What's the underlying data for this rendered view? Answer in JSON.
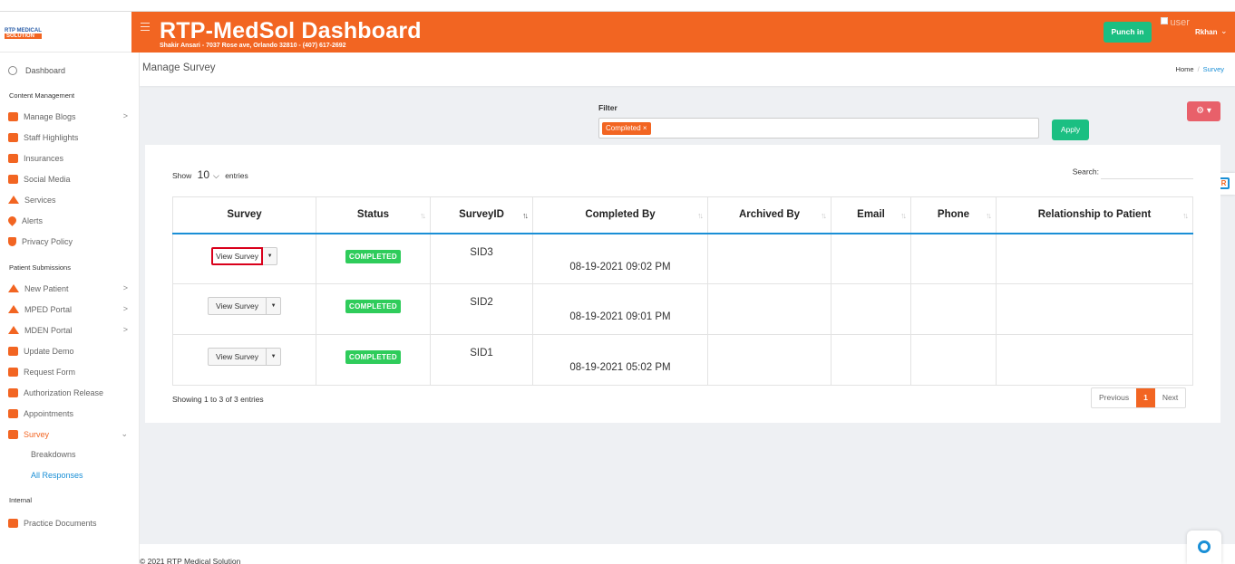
{
  "header": {
    "title": "RTP-MedSol Dashboard",
    "subtitle": "Shakir Ansari - 7037 Rose ave, Orlando 32810 - (407) 617-2692",
    "punch_label": "Punch in",
    "user_alt": "user",
    "user_name": "Rkhan"
  },
  "logo": {
    "line1": "RTP MEDICAL",
    "line2": "SOLUTION"
  },
  "sidebar": {
    "dashboard": "Dashboard",
    "sections": [
      {
        "title": "Content Management",
        "items": [
          "Manage Blogs",
          "Staff Highlights",
          "Insurances",
          "Social Media",
          "Services",
          "Alerts",
          "Privacy Policy"
        ]
      },
      {
        "title": "Patient Submissions",
        "items": [
          "New Patient",
          "MPED Portal",
          "MDEN Portal",
          "Update Demo",
          "Request Form",
          "Authorization Release",
          "Appointments",
          "Survey"
        ]
      },
      {
        "title": "Internal",
        "items": [
          "Practice Documents"
        ]
      }
    ],
    "survey_sub": [
      "Breakdowns",
      "All Responses"
    ]
  },
  "page": {
    "title": "Manage Survey",
    "breadcrumb": [
      "Home",
      "Survey"
    ]
  },
  "filter": {
    "label": "Filter",
    "tag": "Completed ×",
    "apply": "Apply"
  },
  "table": {
    "show": "Show",
    "length": "10",
    "entries": "entries",
    "search_label": "Search:",
    "columns": [
      "Survey",
      "Status",
      "SurveyID",
      "Completed By",
      "Archived By",
      "Email",
      "Phone",
      "Relationship to Patient"
    ],
    "rows": [
      {
        "action": "View Survey",
        "status": "COMPLETED",
        "id": "SID3",
        "completed": "08-19-2021 09:02 PM",
        "archived": "",
        "email": "",
        "phone": "",
        "relationship": ""
      },
      {
        "action": "View Survey",
        "status": "COMPLETED",
        "id": "SID2",
        "completed": "08-19-2021 09:01 PM",
        "archived": "",
        "email": "",
        "phone": "",
        "relationship": ""
      },
      {
        "action": "View Survey",
        "status": "COMPLETED",
        "id": "SID1",
        "completed": "08-19-2021 05:02 PM",
        "archived": "",
        "email": "",
        "phone": "",
        "relationship": ""
      }
    ],
    "info": "Showing 1 to 3 of 3 entries",
    "pager": {
      "prev": "Previous",
      "current": "1",
      "next": "Next"
    }
  },
  "footer": {
    "copyright": "© 2021 RTP Medical Solution"
  },
  "colors": {
    "brand": "#f26522",
    "success": "#1bbf82",
    "link": "#1a8fd6",
    "danger": "#e8606a"
  }
}
